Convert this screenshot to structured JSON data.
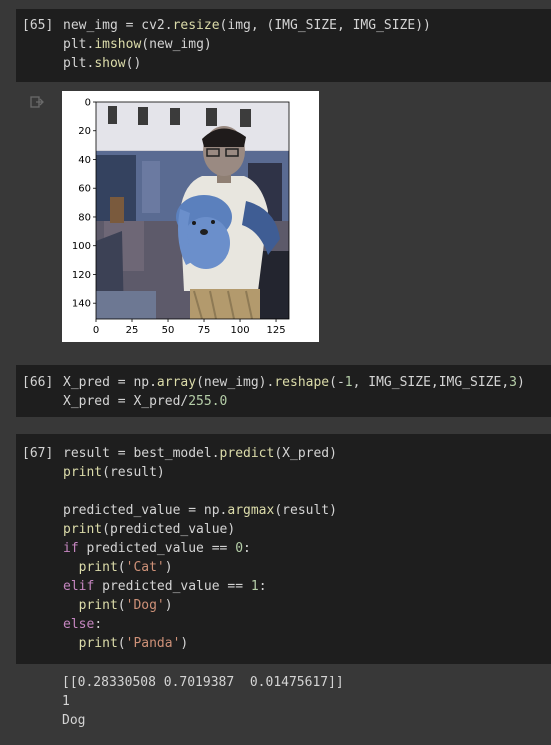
{
  "cells": [
    {
      "prompt": "[65]",
      "lines": [
        "new_img = cv2.resize(img, (IMG_SIZE, IMG_SIZE))",
        "plt.imshow(new_img)",
        "plt.show()"
      ]
    },
    {
      "prompt": "[66]",
      "lines": [
        "X_pred = np.array(new_img).reshape(-1, IMG_SIZE,IMG_SIZE,3)",
        "X_pred = X_pred/255.0"
      ]
    },
    {
      "prompt": "[67]",
      "lines": [
        "result = best_model.predict(X_pred)",
        "print(result)",
        "",
        "predicted_value = np.argmax(result)",
        "print(predicted_value)",
        "if predicted_value == 0:",
        "  print('Cat')",
        "elif predicted_value == 1:",
        "  print('Dog')",
        "else:",
        "  print('Panda')"
      ]
    }
  ],
  "plot": {
    "x_ticks": [
      "0",
      "25",
      "50",
      "75",
      "100",
      "125"
    ],
    "y_ticks": [
      "0",
      "20",
      "40",
      "60",
      "80",
      "100",
      "120",
      "140"
    ]
  },
  "output": {
    "lines": [
      "[[0.28330508 0.7019387  0.01475617]]",
      "1",
      "Dog"
    ]
  },
  "icons": {
    "output_icon": "output-redirect-icon"
  },
  "colors": {
    "background": "#383838",
    "cell_background": "#1e1e1e",
    "keyword": "#c586c0",
    "function": "#dcdcaa",
    "string": "#ce9178",
    "number": "#b5cea8"
  }
}
